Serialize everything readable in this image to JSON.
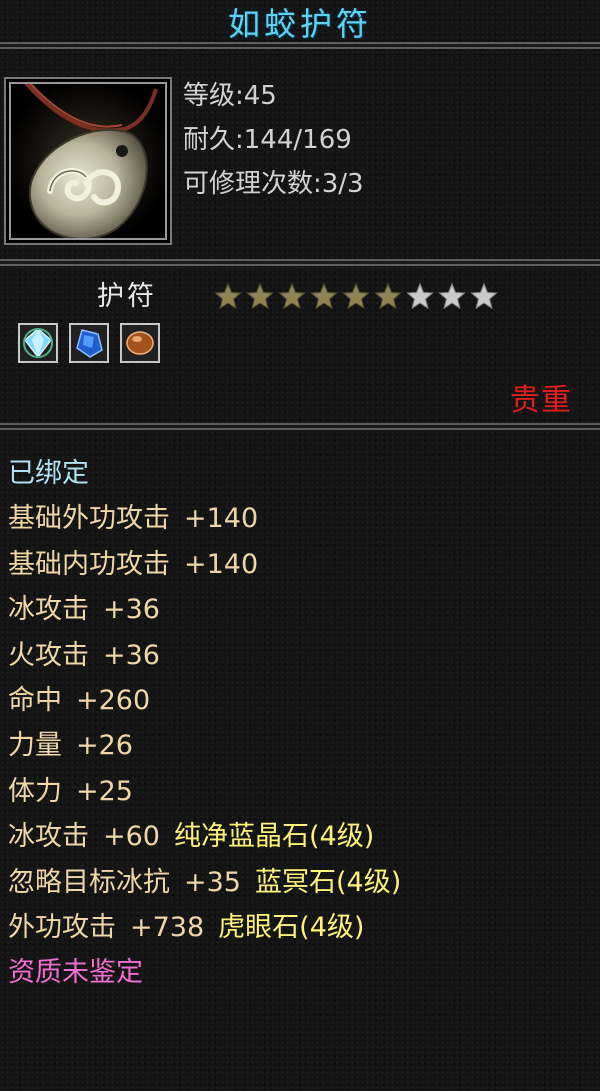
{
  "item": {
    "name": "如蛟护符",
    "icon": "jade-amulet-icon",
    "level": "等级:45",
    "durability": "耐久:144/169",
    "repairs": "可修理次数:3/3",
    "type": "护符",
    "star_rating": {
      "filled": 6,
      "total": 9
    },
    "gems": [
      {
        "icon": "diamond-gem-icon"
      },
      {
        "icon": "blue-crystal-gem-icon"
      },
      {
        "icon": "tiger-eye-gem-icon"
      }
    ],
    "rarity": "贵重"
  },
  "attributes": {
    "bound": "已绑定",
    "lines": [
      {
        "label": "基础外功攻击",
        "value": "+140"
      },
      {
        "label": "基础内功攻击",
        "value": "+140"
      },
      {
        "label": "冰攻击",
        "value": "+36"
      },
      {
        "label": "火攻击",
        "value": "+36"
      },
      {
        "label": "命中",
        "value": "+260"
      },
      {
        "label": "力量",
        "value": "+26"
      },
      {
        "label": "体力",
        "value": "+25"
      }
    ],
    "gem_lines": [
      {
        "label": "冰攻击",
        "value": "+60",
        "gem": "纯净蓝晶石(4级)"
      },
      {
        "label": "忽略目标冰抗",
        "value": "+35",
        "gem": "蓝冥石(4级)"
      },
      {
        "label": "外功攻击",
        "value": "+738",
        "gem": "虎眼石(4级)"
      }
    ],
    "quality": "资质未鉴定"
  },
  "colors": {
    "title": "#5fd1f2",
    "bound": "#aee3f6",
    "attribute": "#f0d6a4",
    "gem_name": "#fff37a",
    "quality": "#f06ed0",
    "rarity": "#e21d1d",
    "star_filled": "#8f8553",
    "star_empty": "#c9c9c9"
  }
}
